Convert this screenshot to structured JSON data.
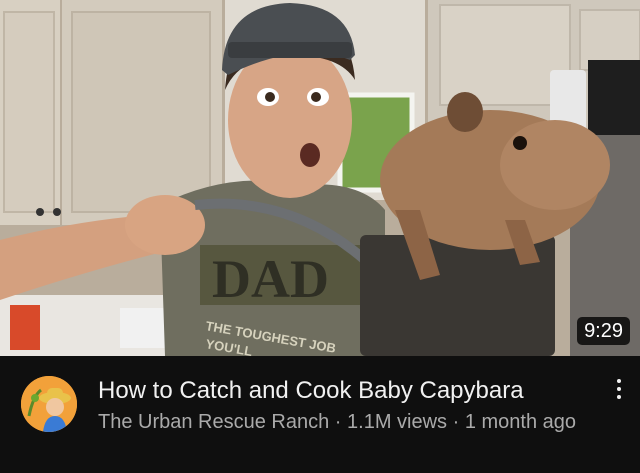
{
  "video": {
    "duration": "9:29",
    "title": "How to Catch and Cook Baby Capybara",
    "channel": "The Urban Rescue Ranch",
    "views": "1.1M views",
    "age": "1 month ago",
    "separator": " · "
  },
  "thumbnail_text": {
    "shirt_big": "DAD",
    "shirt_line1": "THE TOUGHEST JOB",
    "shirt_line2": "YOU'LL"
  },
  "colors": {
    "background": "#0f0f0f",
    "title": "#f1f1f1",
    "meta": "#aaaaaa",
    "avatar_bg": "#f2a13a"
  },
  "icons": {
    "more": "kebab-vertical-icon",
    "avatar": "channel-avatar-icon"
  }
}
